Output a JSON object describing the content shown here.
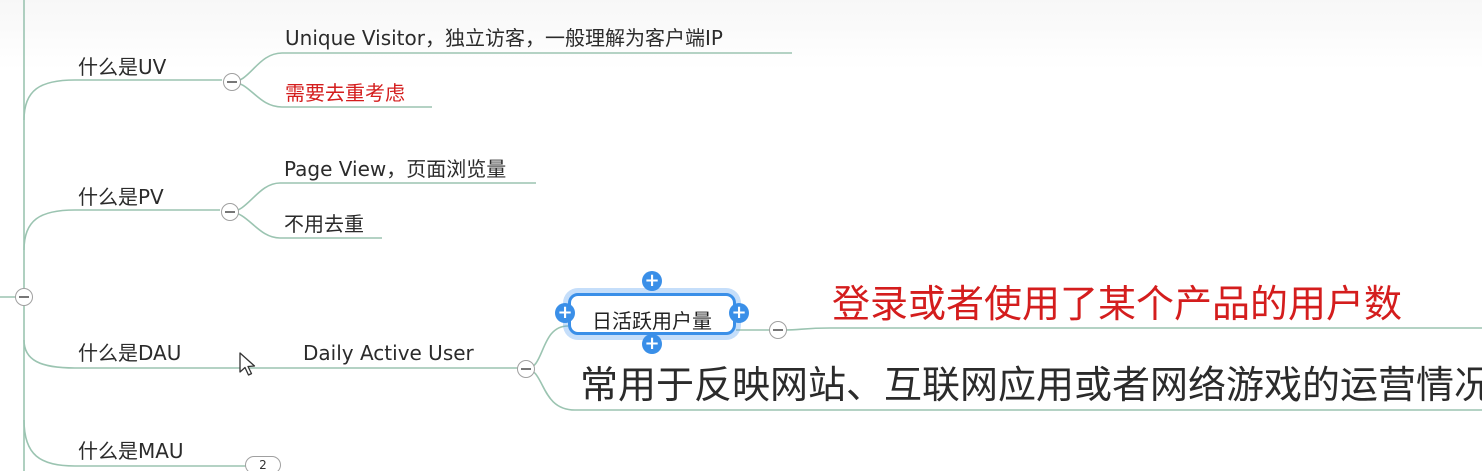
{
  "mindmap": {
    "uv": {
      "title": "什么是UV",
      "leaf1": "Unique Visitor，独立访客，一般理解为客户端IP",
      "leaf2": "需要去重考虑"
    },
    "pv": {
      "title": "什么是PV",
      "leaf1": "Page View，页面浏览量",
      "leaf2": "不用去重"
    },
    "dau": {
      "title": "什么是DAU",
      "child": "Daily Active User",
      "selected": "日活跃用户量",
      "detail_red": "登录或者使用了某个产品的用户数",
      "detail": "常用于反映网站、互联网应用或者网络游戏的运营情况"
    },
    "mau": {
      "title": "什么是MAU",
      "collapsed_count": "2"
    }
  },
  "icons": {
    "toggle": "collapse-minus-icon",
    "handle": "plus-icon",
    "cursor": "mouse-pointer-icon"
  },
  "colors": {
    "branch_line": "#9bc4b1",
    "red_text": "#d41d1d",
    "selection": "#3a8fe8"
  }
}
